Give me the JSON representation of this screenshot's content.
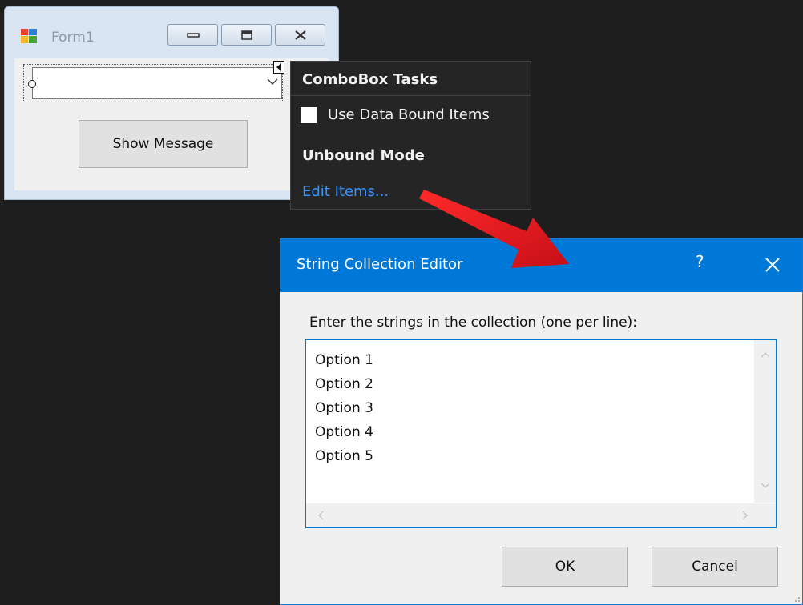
{
  "form1": {
    "title": "Form1",
    "combo_value": "",
    "show_message_label": "Show Message"
  },
  "tasks_panel": {
    "title": "ComboBox Tasks",
    "use_data_bound_items_label": "Use Data Bound Items",
    "use_data_bound_items_checked": false,
    "unbound_mode_heading": "Unbound Mode",
    "edit_items_link": "Edit Items..."
  },
  "dialog": {
    "title": "String Collection Editor",
    "help_label": "?",
    "prompt": "Enter the strings in the collection (one per line):",
    "lines": [
      "Option 1",
      "Option 2",
      "Option 3",
      "Option 4",
      "Option 5"
    ],
    "ok_label": "OK",
    "cancel_label": "Cancel"
  },
  "colors": {
    "dialog_titlebar": "#0078d7",
    "link": "#3794ff",
    "panel_bg": "#252526",
    "arrow": "#e8141c"
  },
  "icons": {
    "form_icon": "app-window-icon",
    "arrow": "annotation-arrow"
  }
}
